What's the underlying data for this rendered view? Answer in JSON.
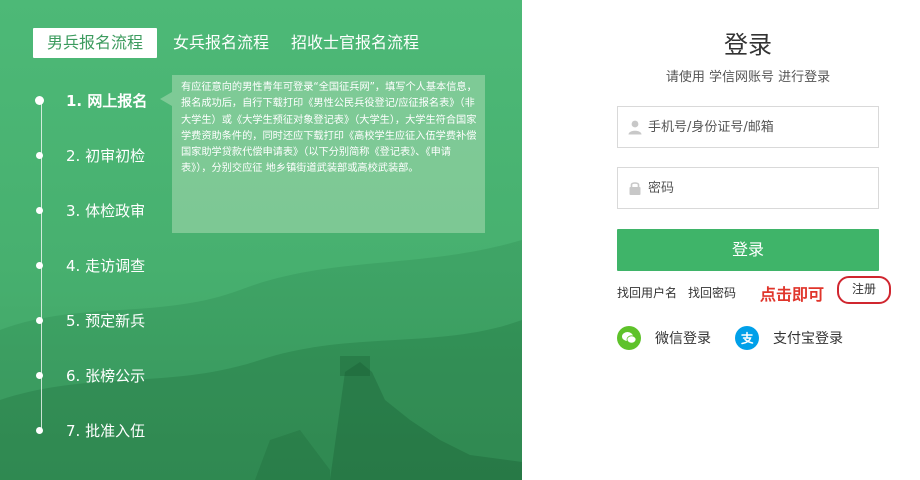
{
  "tabs": [
    "男兵报名流程",
    "女兵报名流程",
    "招收士官报名流程"
  ],
  "steps": [
    "1. 网上报名",
    "2. 初审初检",
    "3. 体检政审",
    "4. 走访调查",
    "5. 预定新兵",
    "6. 张榜公示",
    "7. 批准入伍"
  ],
  "description": "有应征意向的男性青年可登录“全国征兵网”，填写个人基本信息，报名成功后，自行下载打印《男性公民兵役登记/应征报名表》（非大学生）或《大学生预征对象登记表》（大学生），大学生符合国家学费资助条件的，同时还应下载打印《高校学生应征入伍学费补偿国家助学贷款代偿申请表》（以下分别简称《登记表》、《申请表》），分别交应征 地乡镇街道武装部或高校武装部。",
  "login": {
    "title": "登录",
    "subtitle": "请使用  学信网账号  进行登录",
    "username_placeholder": "手机号/身份证号/邮箱",
    "password_placeholder": "密码",
    "button": "登录",
    "find_username": "找回用户名",
    "find_password": "找回密码",
    "hint": "点击即可",
    "register": "注册",
    "wechat": "微信登录",
    "alipay": "支付宝登录"
  },
  "colors": {
    "panel_green": "#4db977",
    "button_green": "#3fb469",
    "highlight_red": "#d0262f",
    "wechat_green": "#5ec22a",
    "alipay_blue": "#00a0e9"
  },
  "icons": {
    "username": "user-icon",
    "password": "lock-icon",
    "wechat": "wechat-icon",
    "alipay": "alipay-icon"
  }
}
